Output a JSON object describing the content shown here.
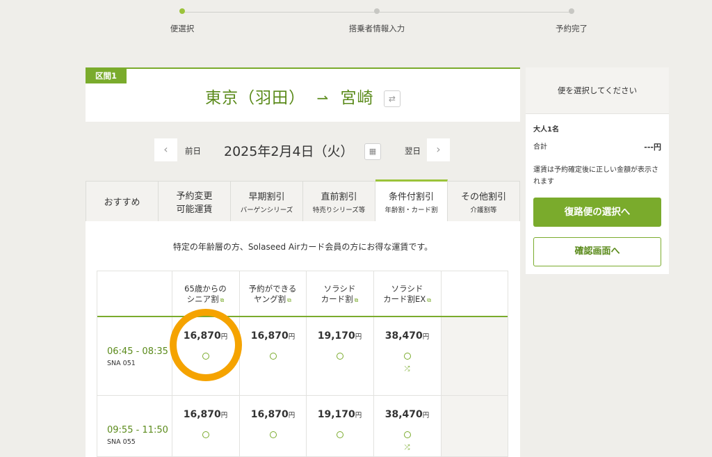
{
  "steps": [
    "便選択",
    "搭乗者情報入力",
    "予約完了"
  ],
  "route": {
    "section_tag": "区間1",
    "origin": "東京（羽田）",
    "arrow": "⇀",
    "destination": "宮崎",
    "swap_icon": "⇄"
  },
  "date_nav": {
    "prev_label": "前日",
    "date": "2025年2月4日（火）",
    "next_label": "翌日",
    "prev_icon": "‹",
    "next_icon": "›",
    "calendar_icon": "▦"
  },
  "tabs": [
    {
      "line1": "おすすめ",
      "line2": "",
      "sub": ""
    },
    {
      "line1": "予約変更",
      "line2": "可能運賃",
      "sub": ""
    },
    {
      "line1": "早期割引",
      "line2": "",
      "sub": "バーゲンシリーズ"
    },
    {
      "line1": "直前割引",
      "line2": "",
      "sub": "特売りシリーズ等"
    },
    {
      "line1": "条件付割引",
      "line2": "",
      "sub": "年齢割・カード割"
    },
    {
      "line1": "その他割引",
      "line2": "",
      "sub": "介護割等"
    }
  ],
  "active_tab": 4,
  "description": "特定の年齢層の方、Solaseed Airカード会員の方にお得な運賃です。",
  "fare_headers": [
    {
      "line1": "65歳からの",
      "line2": "シニア割"
    },
    {
      "line1": "予約ができる",
      "line2": "ヤング割"
    },
    {
      "line1": "ソラシド",
      "line2": "カード割"
    },
    {
      "line1": "ソラシド",
      "line2": "カード割EX"
    }
  ],
  "flights": [
    {
      "time": "06:45 - 08:35",
      "flight_no": "SNA 051",
      "fares": [
        "16,870",
        "16,870",
        "19,170",
        "38,470"
      ]
    },
    {
      "time": "09:55 - 11:50",
      "flight_no": "SNA 055",
      "fares": [
        "16,870",
        "16,870",
        "19,170",
        "38,470"
      ]
    }
  ],
  "yen": "円",
  "avail_mark": "○",
  "shuffle_icon": "⤮",
  "link_icon": "⧉",
  "sidebar": {
    "header": "便を選択してください",
    "passengers": "大人1名",
    "total_label": "合計",
    "total_value": "---円",
    "note": "運賃は予約確定後に正しい金額が表示されます",
    "primary_button": "復路便の選択へ",
    "secondary_button": "確認画面へ"
  },
  "colors": {
    "brand_green": "#7aab2c",
    "highlight": "#f5a300"
  }
}
